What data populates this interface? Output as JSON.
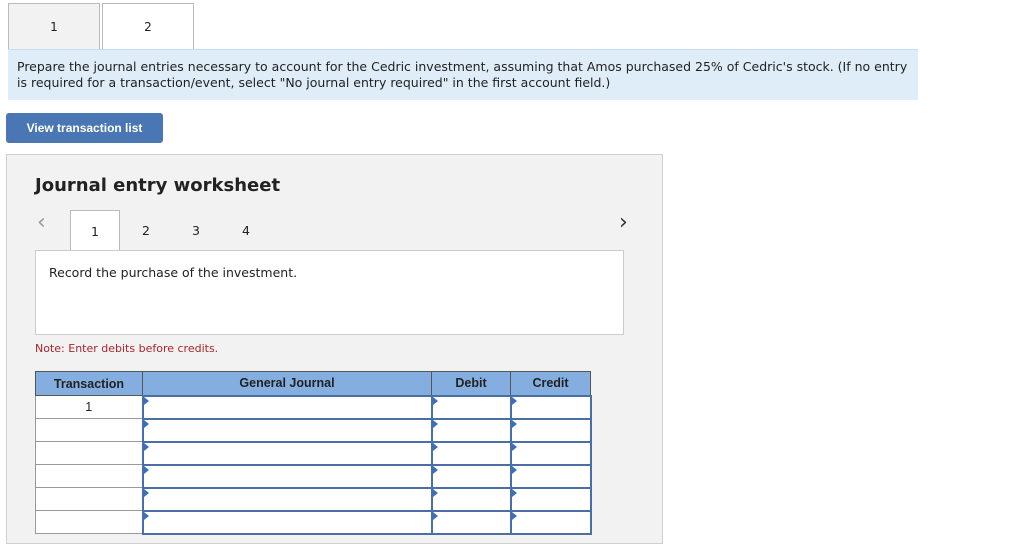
{
  "part_tabs": [
    {
      "label": "1",
      "active": false
    },
    {
      "label": "2",
      "active": true
    }
  ],
  "instructions": "Prepare the journal entries necessary to account for the Cedric investment, assuming that Amos purchased 25% of Cedric's stock. (If no entry is required for a transaction/event, select \"No journal entry required\" in the first account field.)",
  "view_button": "View transaction list",
  "worksheet": {
    "title": "Journal entry worksheet",
    "tabs": [
      "1",
      "2",
      "3",
      "4"
    ],
    "active_tab": "1",
    "prev_icon": "chevron-left-icon",
    "next_icon": "chevron-right-icon",
    "prompt": "Record the purchase of the investment.",
    "note": "Note: Enter debits before credits.",
    "table": {
      "headers": [
        "Transaction",
        "General Journal",
        "Debit",
        "Credit"
      ],
      "rows": [
        [
          "1",
          "",
          "",
          ""
        ],
        [
          "",
          "",
          "",
          ""
        ],
        [
          "",
          "",
          "",
          ""
        ],
        [
          "",
          "",
          "",
          ""
        ],
        [
          "",
          "",
          "",
          ""
        ],
        [
          "",
          "",
          "",
          ""
        ]
      ]
    }
  },
  "colors": {
    "accent": "#4a77b4",
    "header": "#84aee0",
    "instruction_bg": "#dfedf9",
    "note": "#a6262c"
  }
}
